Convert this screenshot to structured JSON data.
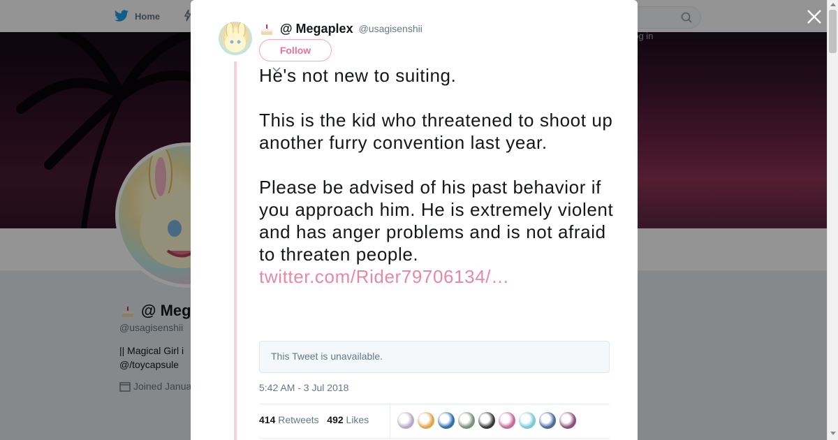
{
  "nav": {
    "home_label": "Home",
    "login_label": "Log in"
  },
  "profile": {
    "name": "@ Megaplex",
    "handle": "@usagisenshii",
    "bio_line1": "|| Magical Girl i",
    "bio_line2": "@/toycapsule",
    "joined": "Joined Janua"
  },
  "tweet": {
    "name": "@ Megaplex",
    "handle": "@usagisenshii",
    "follow_label": "Follow",
    "text": "He's not new to suiting.\n\nThis is the kid who threatened to shoot up another furry convention last year.\n\nPlease be advised of his past behavior if you approach him. He is extremely violent and has anger problems and is not afraid to threaten people.",
    "link": "twitter.com/Rider79706134/…",
    "quote_unavailable": "This Tweet is unavailable.",
    "timestamp": "5:42 AM - 3 Jul 2018",
    "retweets_count": "414",
    "retweets_label": "Retweets",
    "likes_count": "492",
    "likes_label": "Likes"
  },
  "icons": [
    "twitter-bird-icon",
    "moments-icon",
    "search-icon",
    "cake-icon",
    "close-icon",
    "caret-down-icon",
    "calendar-icon"
  ],
  "colors": {
    "accent": "#e589a4",
    "twitter_blue": "#1da1f2",
    "thread_line": "#f8d0dc"
  },
  "liker_colors": [
    "#b9a7c8",
    "#e3a34b",
    "#2f6fb0",
    "#7a8f7e",
    "#3a3a3a",
    "#c56a9a",
    "#78c9d3",
    "#4a6aa0",
    "#8d4f7a"
  ]
}
